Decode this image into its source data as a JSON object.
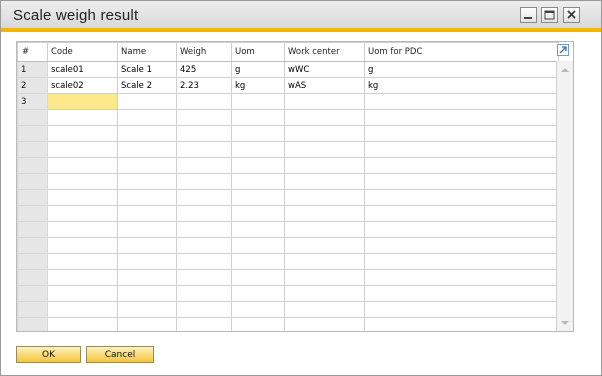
{
  "window": {
    "title": "Scale weigh result"
  },
  "grid": {
    "columns": [
      "#",
      "Code",
      "Name",
      "Weigh",
      "Uom",
      "Work center",
      "Uom for PDC"
    ],
    "rows": [
      [
        "1",
        "scale01",
        "Scale 1",
        "425",
        "g",
        "wWC",
        "g"
      ],
      [
        "2",
        "scale02",
        "Scale 2",
        "2.23",
        "kg",
        "wAS",
        "kg"
      ],
      [
        "3",
        "",
        "",
        "",
        "",
        "",
        ""
      ]
    ],
    "empty_rows": 14
  },
  "buttons": {
    "ok": "OK",
    "cancel": "Cancel"
  },
  "colors": {
    "accent": "#f2b500",
    "active_cell": "#fde98c",
    "button": "#f3c63a"
  }
}
